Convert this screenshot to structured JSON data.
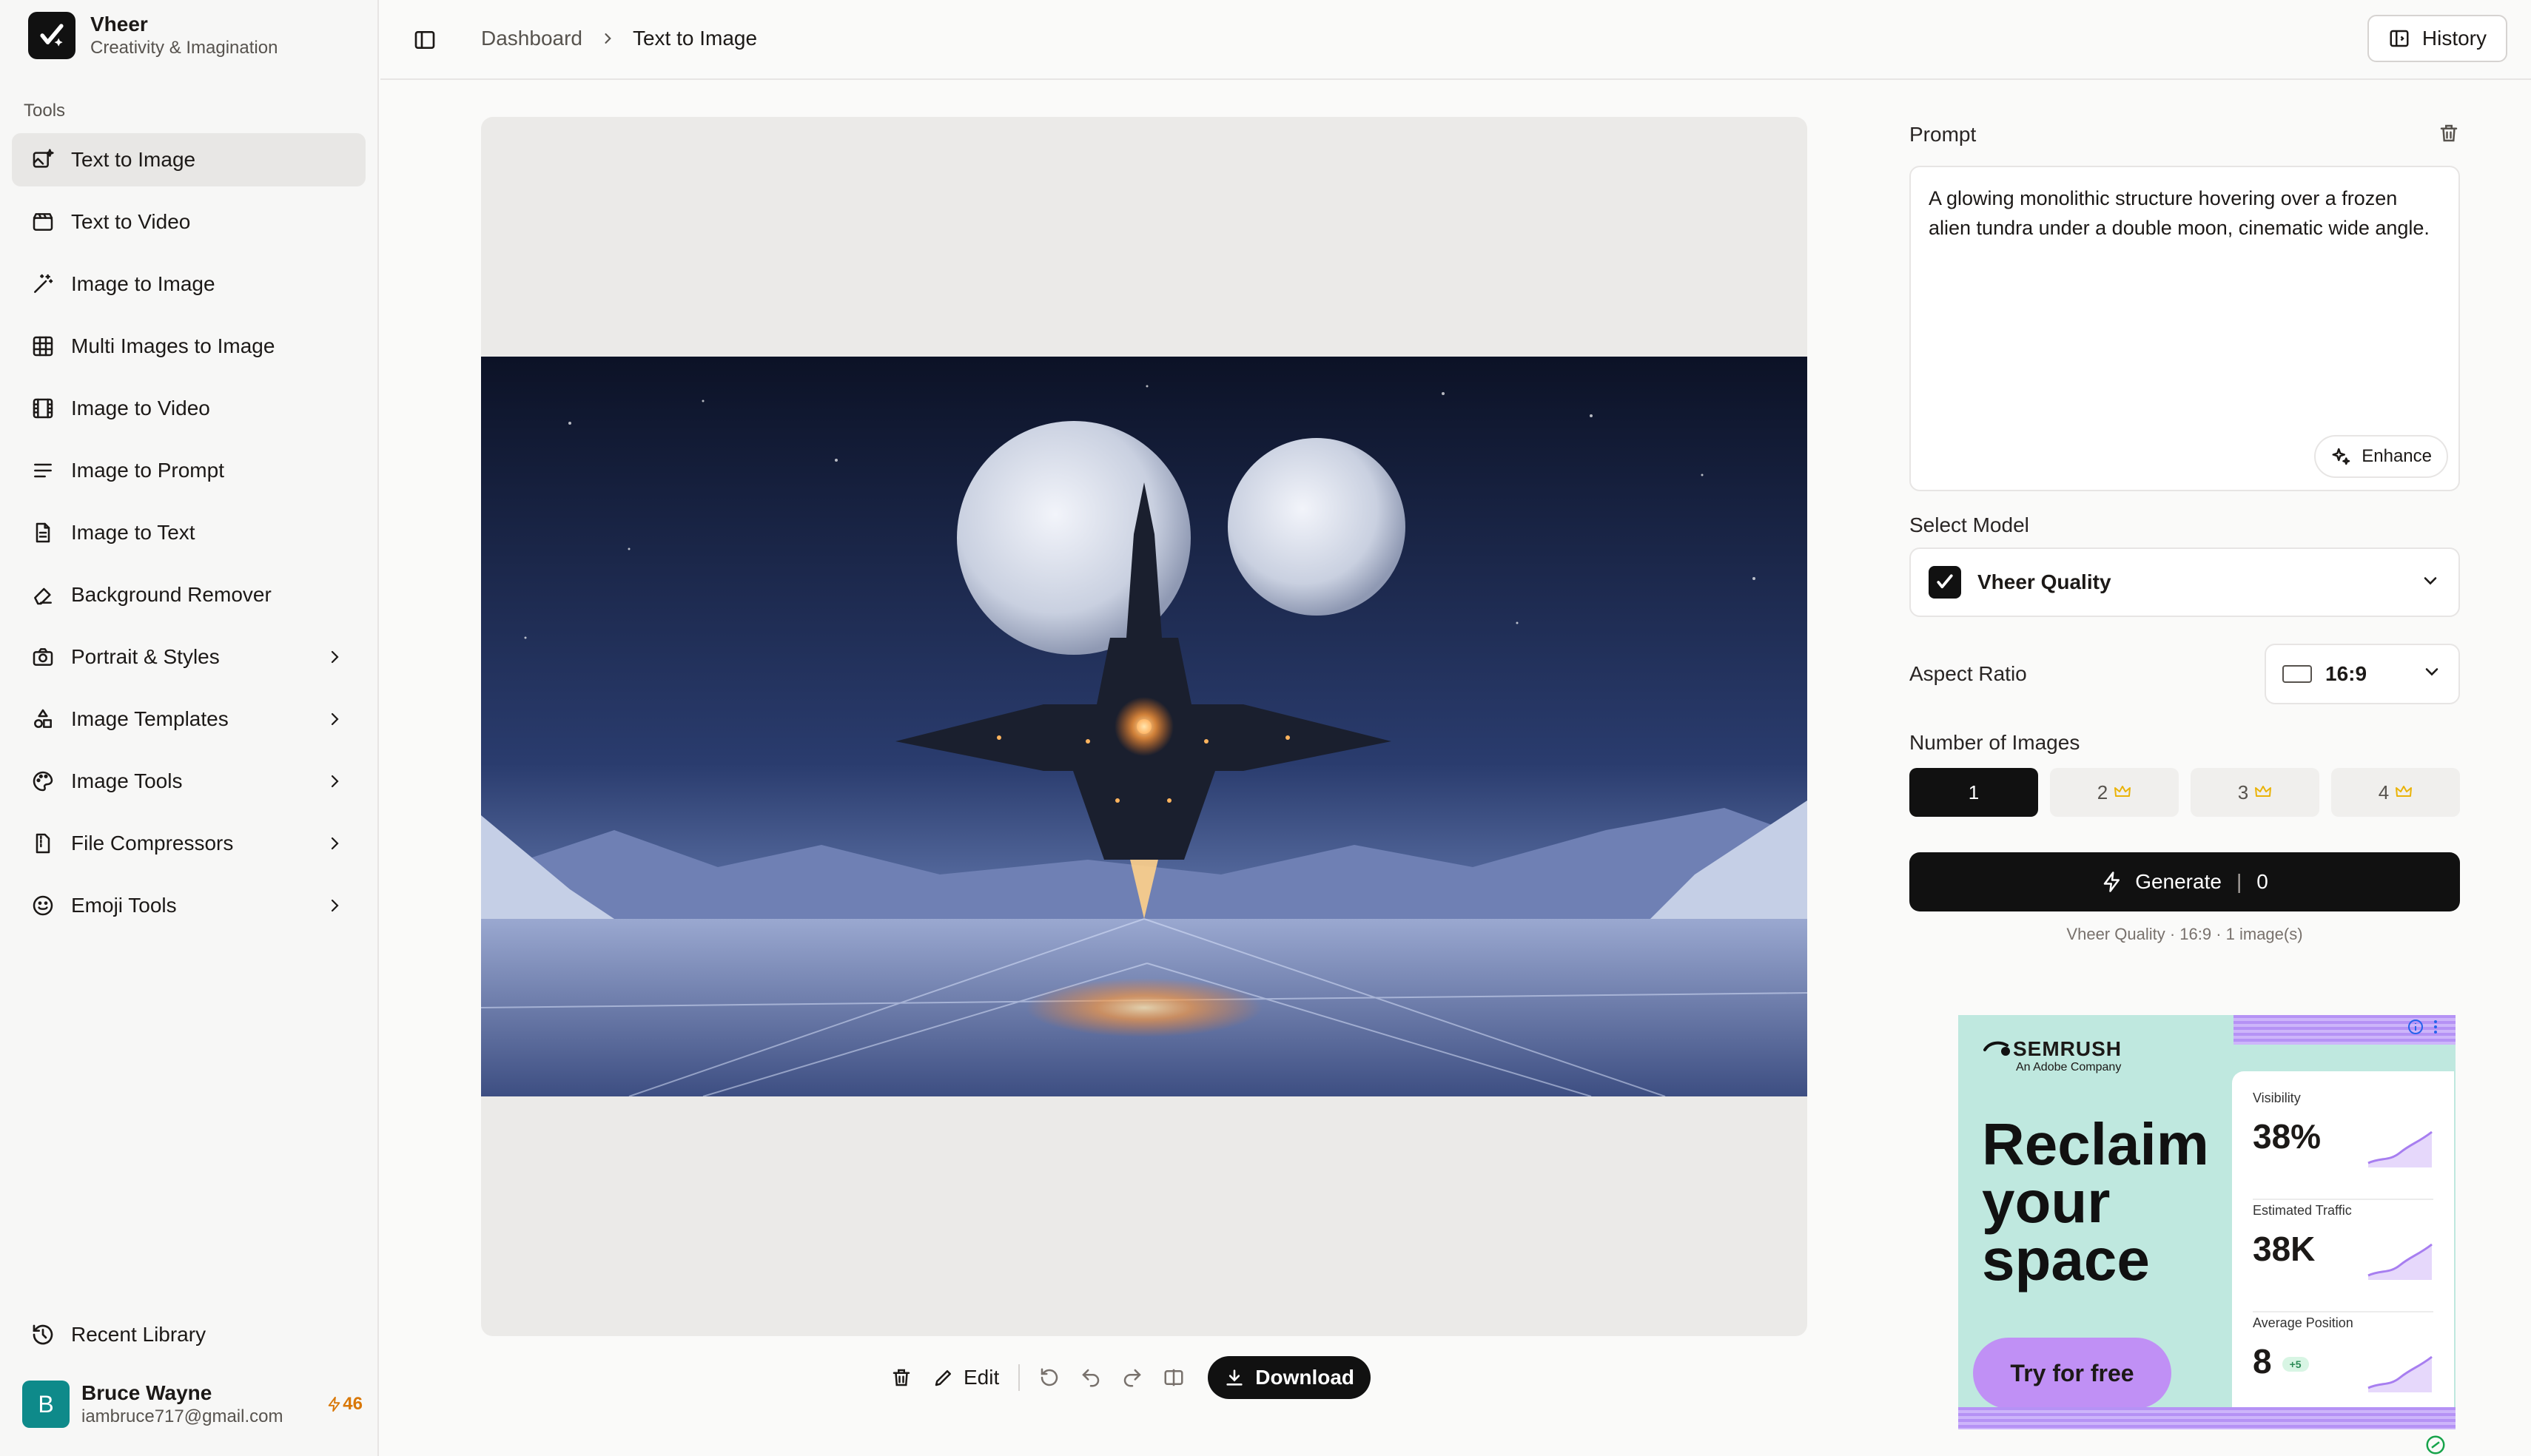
{
  "brand": {
    "name": "Vheer",
    "tagline": "Creativity & Imagination"
  },
  "sidebar": {
    "section_label": "Tools",
    "items": [
      {
        "label": "Text to Image",
        "icon": "image-sparkle-icon",
        "active": true,
        "has_submenu": false
      },
      {
        "label": "Text to Video",
        "icon": "clapperboard-icon",
        "active": false,
        "has_submenu": false
      },
      {
        "label": "Image to Image",
        "icon": "magic-wand-icon",
        "active": false,
        "has_submenu": false
      },
      {
        "label": "Multi Images to Image",
        "icon": "grid-icon",
        "active": false,
        "has_submenu": false
      },
      {
        "label": "Image to Video",
        "icon": "film-icon",
        "active": false,
        "has_submenu": false
      },
      {
        "label": "Image to Prompt",
        "icon": "text-lines-icon",
        "active": false,
        "has_submenu": false
      },
      {
        "label": "Image to Text",
        "icon": "document-icon",
        "active": false,
        "has_submenu": false
      },
      {
        "label": "Background Remover",
        "icon": "eraser-icon",
        "active": false,
        "has_submenu": false
      },
      {
        "label": "Portrait & Styles",
        "icon": "camera-icon",
        "active": false,
        "has_submenu": true
      },
      {
        "label": "Image Templates",
        "icon": "shapes-icon",
        "active": false,
        "has_submenu": true
      },
      {
        "label": "Image Tools",
        "icon": "palette-icon",
        "active": false,
        "has_submenu": true
      },
      {
        "label": "File Compressors",
        "icon": "file-zip-icon",
        "active": false,
        "has_submenu": true
      },
      {
        "label": "Emoji Tools",
        "icon": "smiley-icon",
        "active": false,
        "has_submenu": true
      }
    ],
    "recent_label": "Recent Library"
  },
  "user": {
    "initial": "B",
    "name": "Bruce Wayne",
    "email": "iambruce717@gmail.com",
    "credits": "46"
  },
  "topbar": {
    "breadcrumb": {
      "parent": "Dashboard",
      "current": "Text to Image"
    },
    "history_label": "History"
  },
  "toolbar": {
    "edit_label": "Edit",
    "download_label": "Download"
  },
  "panel": {
    "prompt_label": "Prompt",
    "prompt_text": "A glowing monolithic structure hovering over a frozen alien tundra under a double moon, cinematic wide angle.",
    "enhance_label": "Enhance",
    "model_label": "Select Model",
    "model_value": "Vheer Quality",
    "aspect_label": "Aspect Ratio",
    "aspect_value": "16:9",
    "count_label": "Number of Images",
    "count_options": [
      {
        "label": "1",
        "selected": true,
        "premium": false
      },
      {
        "label": "2",
        "selected": false,
        "premium": true
      },
      {
        "label": "3",
        "selected": false,
        "premium": true
      },
      {
        "label": "4",
        "selected": false,
        "premium": true
      }
    ],
    "generate_label": "Generate",
    "generate_cost": "0",
    "summary": "Vheer Quality · 16:9 · 1 image(s)"
  },
  "ad": {
    "brand": "SEMRUSH",
    "brand_sub": "An Adobe Company",
    "headline": "Reclaim your space",
    "cta": "Try for free",
    "metrics": [
      {
        "label": "Visibility",
        "value": "38%",
        "badge": ""
      },
      {
        "label": "Estimated Traffic",
        "value": "38K",
        "badge": ""
      },
      {
        "label": "Average Position",
        "value": "8",
        "badge": "+5"
      }
    ]
  },
  "colors": {
    "accent": "#111111",
    "active_nav": "#e8e7e5",
    "credits": "#d97706",
    "ad_bg": "#bfe8df",
    "ad_cta": "#c090f5"
  }
}
